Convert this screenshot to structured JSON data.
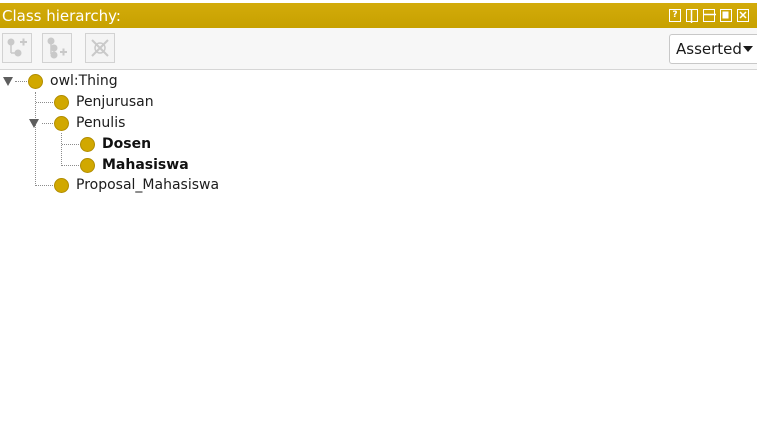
{
  "title_bar": {
    "title": "Class hierarchy:",
    "buttons": [
      {
        "name": "help",
        "glyph": "?"
      },
      {
        "name": "split-vertical"
      },
      {
        "name": "split-horizontal"
      },
      {
        "name": "maximize"
      },
      {
        "name": "close"
      }
    ],
    "colors": {
      "background": "#c9a200",
      "text": "#ffffff"
    }
  },
  "toolbar": {
    "buttons": [
      {
        "name": "add-subclass",
        "icon": "add-subclass-icon",
        "enabled": false
      },
      {
        "name": "add-sibling-class",
        "icon": "add-sibling-class-icon",
        "enabled": false
      },
      {
        "name": "delete-class",
        "icon": "delete-class-icon",
        "enabled": false
      }
    ],
    "view_mode": {
      "selected": "Asserted"
    }
  },
  "tree": {
    "bullet_color": "#d1a800",
    "nodes": [
      {
        "label": "owl:Thing",
        "bold": false,
        "expanded": true
      },
      {
        "label": "Penjurusan",
        "bold": false
      },
      {
        "label": "Penulis",
        "bold": false,
        "expanded": true
      },
      {
        "label": "Dosen",
        "bold": true
      },
      {
        "label": "Mahasiswa",
        "bold": true
      },
      {
        "label": "Proposal_Mahasiswa",
        "bold": false
      }
    ]
  }
}
